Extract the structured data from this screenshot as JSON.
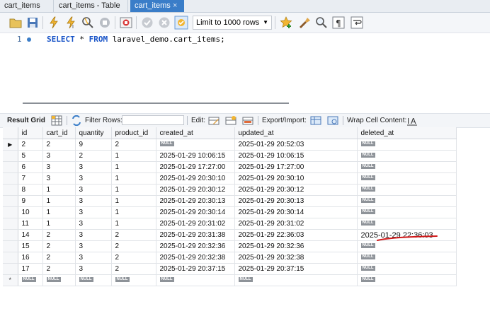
{
  "tabs": [
    {
      "label": "cart_items",
      "active": false
    },
    {
      "label": "cart_items - Table",
      "active": false
    },
    {
      "label": "cart_items",
      "active": true
    }
  ],
  "tab_close": "×",
  "toolbar": {
    "limit_value": "Limit to 1000 rows"
  },
  "editor": {
    "line_number": "1",
    "sql_keywords": [
      "SELECT",
      "FROM"
    ],
    "sql_star": " * ",
    "sql_target": " laravel_demo.cart_items;"
  },
  "result_bar": {
    "result_grid": "Result Grid",
    "filter_rows": "Filter Rows:",
    "edit": "Edit:",
    "export_import": "Export/Import:",
    "wrap_cell": "Wrap Cell Content:"
  },
  "grid": {
    "columns": [
      "id",
      "cart_id",
      "quantity",
      "product_id",
      "created_at",
      "updated_at",
      "deleted_at"
    ],
    "null_label": "NULL",
    "rows": [
      [
        "2",
        "2",
        "9",
        "2",
        null,
        "2025-01-29 20:52:03",
        null
      ],
      [
        "5",
        "3",
        "2",
        "1",
        "2025-01-29 10:06:15",
        "2025-01-29 10:06:15",
        null
      ],
      [
        "6",
        "3",
        "3",
        "1",
        "2025-01-29 17:27:00",
        "2025-01-29 17:27:00",
        null
      ],
      [
        "7",
        "3",
        "3",
        "1",
        "2025-01-29 20:30:10",
        "2025-01-29 20:30:10",
        null
      ],
      [
        "8",
        "1",
        "3",
        "1",
        "2025-01-29 20:30:12",
        "2025-01-29 20:30:12",
        null
      ],
      [
        "9",
        "1",
        "3",
        "1",
        "2025-01-29 20:30:13",
        "2025-01-29 20:30:13",
        null
      ],
      [
        "10",
        "1",
        "3",
        "1",
        "2025-01-29 20:30:14",
        "2025-01-29 20:30:14",
        null
      ],
      [
        "11",
        "1",
        "3",
        "1",
        "2025-01-29 20:31:02",
        "2025-01-29 20:31:02",
        null
      ],
      [
        "14",
        "2",
        "3",
        "2",
        "2025-01-29 20:31:38",
        "2025-01-29 22:36:03",
        "2025-01-29 22:36:03"
      ],
      [
        "15",
        "2",
        "3",
        "2",
        "2025-01-29 20:32:36",
        "2025-01-29 20:32:36",
        null
      ],
      [
        "16",
        "2",
        "3",
        "2",
        "2025-01-29 20:32:38",
        "2025-01-29 20:32:38",
        null
      ],
      [
        "17",
        "2",
        "3",
        "2",
        "2025-01-29 20:37:15",
        "2025-01-29 20:37:15",
        null
      ]
    ],
    "new_row_marker": "*",
    "current_row_marker": "▶"
  },
  "colors": {
    "active_tab": "#3a7dc8",
    "keyword": "#1a55c8",
    "annotation": "#d01818"
  }
}
